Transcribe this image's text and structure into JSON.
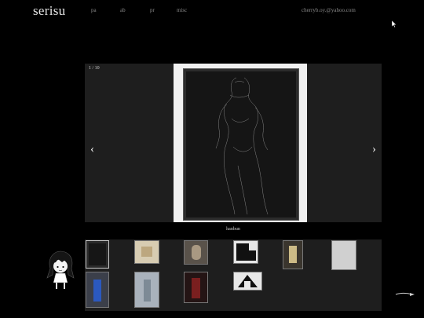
{
  "site": {
    "logo": "serisu"
  },
  "nav": {
    "items": [
      "pa",
      "ab",
      "pr",
      "misc"
    ]
  },
  "contact": {
    "email": "cherryb.oy.@yahoo.com"
  },
  "viewer": {
    "counter": "1 / 10",
    "prev_label": "‹",
    "next_label": "›",
    "caption": "hanbun"
  },
  "thumbnails": {
    "count": 10,
    "selected_index": 0,
    "icons": [
      "dark-painting",
      "beige-sketch",
      "figure-portrait",
      "black-white-collage",
      "dark-figure",
      "pale-canvas",
      "blue-figure",
      "light-figure",
      "red-figure",
      "pyramid-sketch"
    ]
  },
  "icons": {
    "mascot": "girl-mascot-icon",
    "scroll": "scroll-arrow-icon",
    "cursor": "mouse-cursor-icon"
  }
}
